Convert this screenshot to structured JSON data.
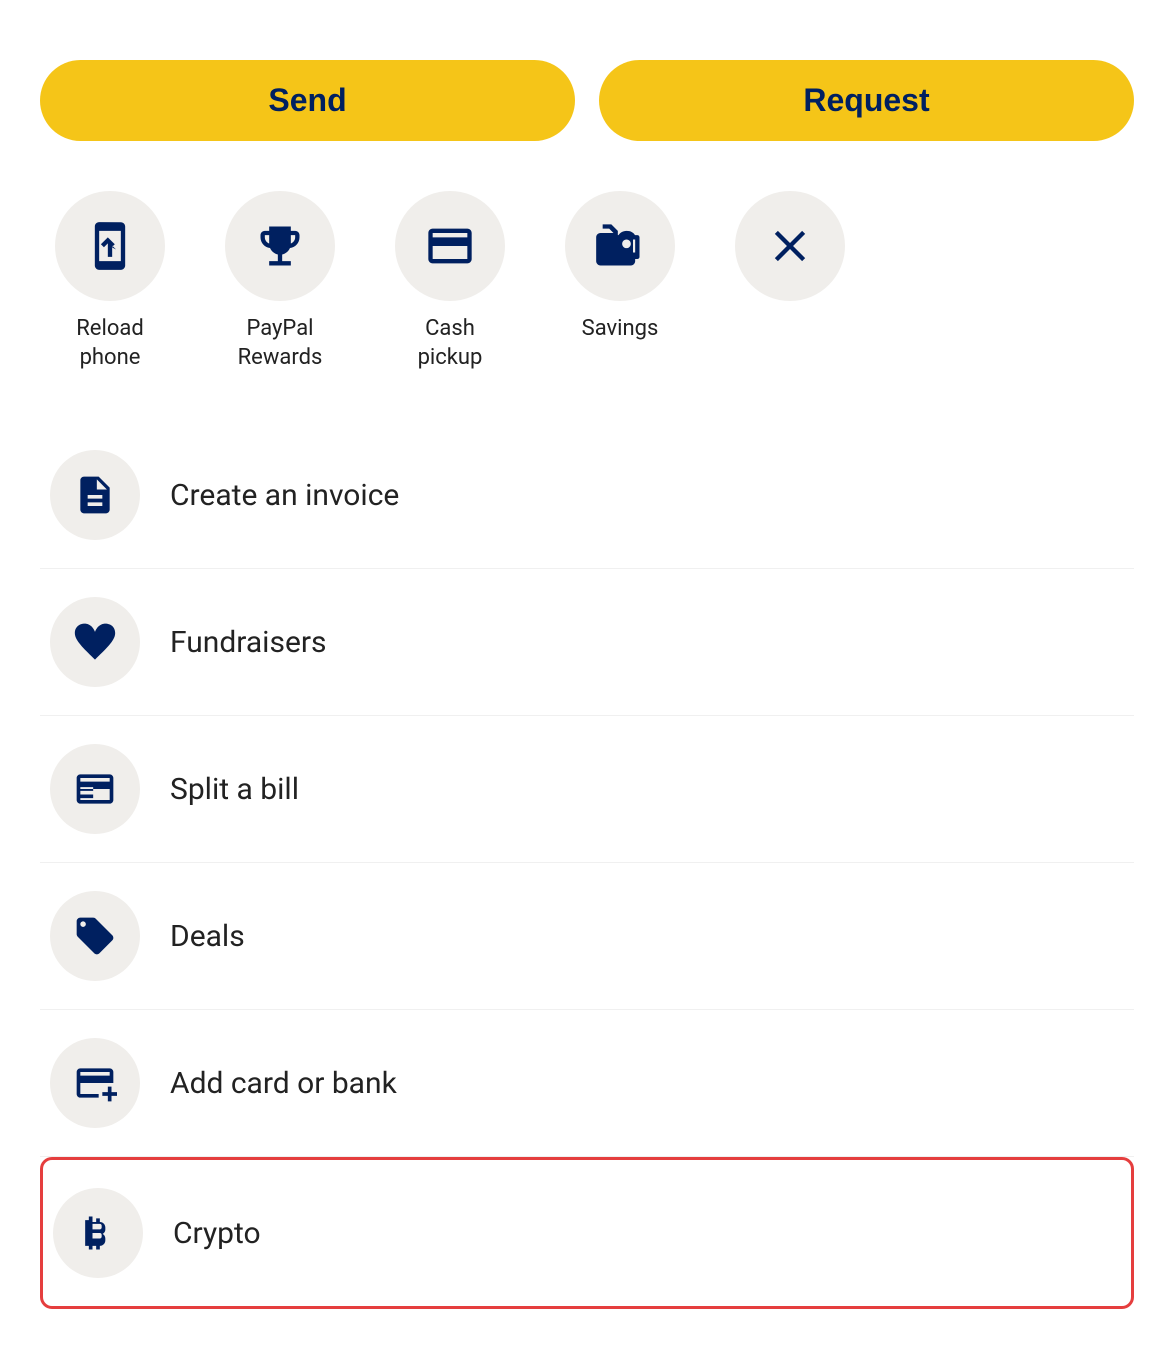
{
  "buttons": {
    "send_label": "Send",
    "request_label": "Request"
  },
  "icon_items": [
    {
      "id": "reload-phone",
      "label": "Reload\nphone",
      "icon": "reload-phone-icon"
    },
    {
      "id": "paypal-rewards",
      "label": "PayPal\nRewards",
      "icon": "trophy-icon"
    },
    {
      "id": "cash-pickup",
      "label": "Cash\npickup",
      "icon": "cash-pickup-icon"
    },
    {
      "id": "savings",
      "label": "Savings",
      "icon": "savings-icon"
    },
    {
      "id": "close",
      "label": "",
      "icon": "close-icon"
    }
  ],
  "list_items": [
    {
      "id": "create-invoice",
      "label": "Create an invoice",
      "icon": "invoice-icon"
    },
    {
      "id": "fundraisers",
      "label": "Fundraisers",
      "icon": "fundraisers-icon"
    },
    {
      "id": "split-bill",
      "label": "Split a bill",
      "icon": "split-bill-icon"
    },
    {
      "id": "deals",
      "label": "Deals",
      "icon": "deals-icon"
    },
    {
      "id": "add-card-bank",
      "label": "Add card or bank",
      "icon": "add-card-icon"
    },
    {
      "id": "crypto",
      "label": "Crypto",
      "icon": "crypto-icon"
    }
  ],
  "colors": {
    "primary_bg": "#F5C518",
    "icon_bg": "#f0eeeb",
    "navy": "#002060",
    "text": "#222222",
    "highlight_border": "#e53e3e"
  }
}
